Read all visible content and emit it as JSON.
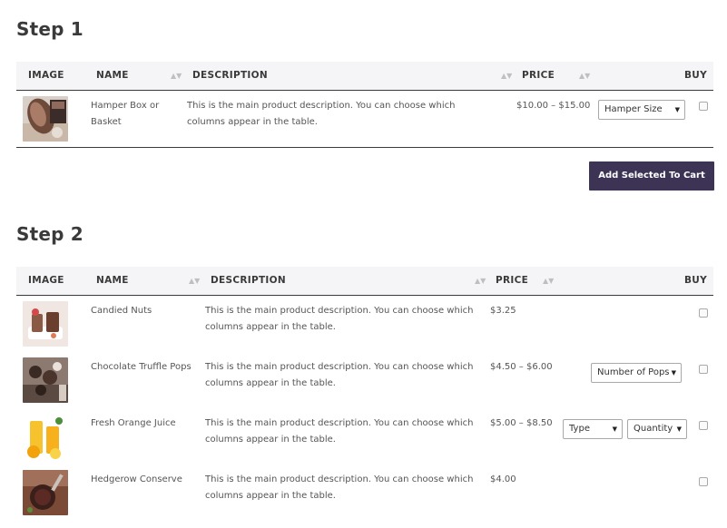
{
  "step1": {
    "title": "Step 1",
    "headers": {
      "image": "IMAGE",
      "name": "NAME",
      "description": "DESCRIPTION",
      "price": "PRICE",
      "buy": "BUY"
    },
    "rows": [
      {
        "name": "Hamper Box or Basket",
        "description": "This is the main product description. You can choose which columns appear in the table.",
        "price": "$10.00 – $15.00",
        "selects": [
          "Hamper Size"
        ]
      }
    ],
    "cart_button": "Add Selected To Cart"
  },
  "step2": {
    "title": "Step 2",
    "headers": {
      "image": "IMAGE",
      "name": "NAME",
      "description": "DESCRIPTION",
      "price": "PRICE",
      "buy": "BUY"
    },
    "rows": [
      {
        "name": "Candied Nuts",
        "description": "This is the main product description. You can choose which columns appear in the table.",
        "price": "$3.25"
      },
      {
        "name": "Chocolate Truffle Pops",
        "description": "This is the main product description. You can choose which columns appear in the table.",
        "price": "$4.50 – $6.00",
        "selects": [
          "Number of Pops"
        ]
      },
      {
        "name": "Fresh Orange Juice",
        "description": "This is the main product description. You can choose which columns appear in the table.",
        "price": "$5.00 – $8.50",
        "selects": [
          "Type",
          "Quantity"
        ]
      },
      {
        "name": "Hedgerow Conserve",
        "description": "This is the main product description. You can choose which columns appear in the table.",
        "price": "$4.00"
      }
    ]
  },
  "icons": {
    "sort": "sort-icon",
    "caret": "chevron-down-icon",
    "checkbox": "checkbox-icon"
  },
  "colors": {
    "accent": "#3c3355",
    "header_bg": "#f5f5f7"
  }
}
